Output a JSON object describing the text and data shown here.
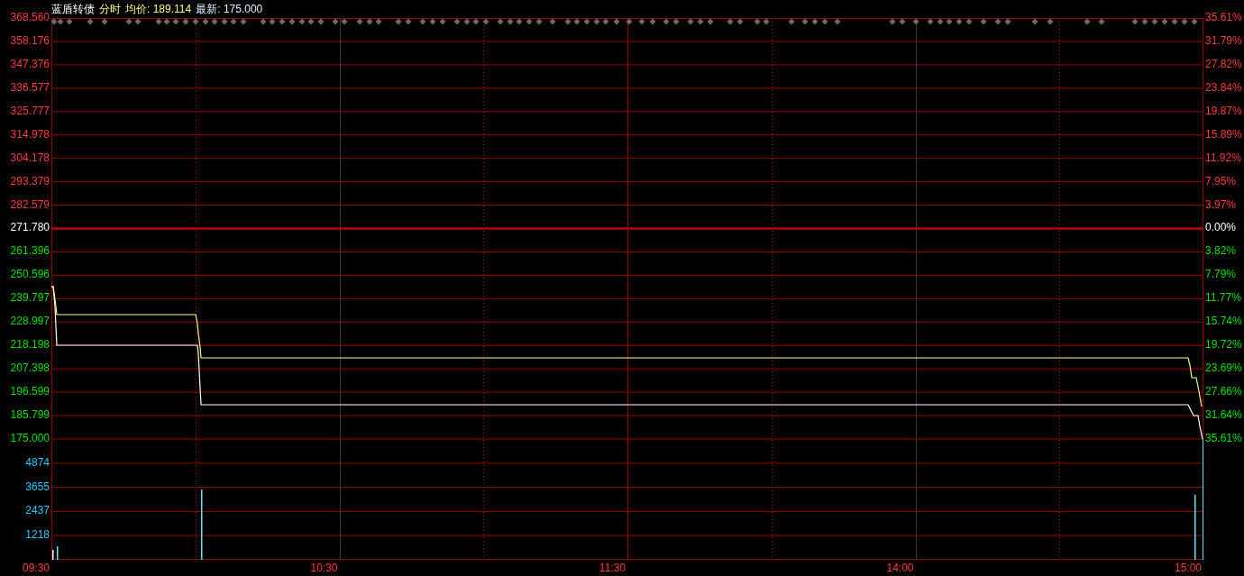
{
  "header": {
    "name": "蓝盾转债",
    "mode": "分时",
    "average": {
      "label": "均价:",
      "value": "189.114"
    },
    "latest": {
      "label": "最新:",
      "value": "175.000"
    }
  },
  "price_axis": [
    {
      "label": "368.560",
      "color": "#ff3b3b"
    },
    {
      "label": "358.176",
      "color": "#ff3b3b"
    },
    {
      "label": "347.376",
      "color": "#ff3b3b"
    },
    {
      "label": "336.577",
      "color": "#ff3b3b"
    },
    {
      "label": "325.777",
      "color": "#ff3b3b"
    },
    {
      "label": "314.978",
      "color": "#ff3b3b"
    },
    {
      "label": "304.178",
      "color": "#ff3b3b"
    },
    {
      "label": "293.379",
      "color": "#ff3b3b"
    },
    {
      "label": "282.579",
      "color": "#ff3b3b"
    },
    {
      "label": "271.780",
      "color": "#ffffff"
    },
    {
      "label": "261.396",
      "color": "#00e600"
    },
    {
      "label": "250.596",
      "color": "#00e600"
    },
    {
      "label": "239.797",
      "color": "#00e600"
    },
    {
      "label": "228.997",
      "color": "#00e600"
    },
    {
      "label": "218.198",
      "color": "#00e600"
    },
    {
      "label": "207.398",
      "color": "#00e600"
    },
    {
      "label": "196.599",
      "color": "#00e600"
    },
    {
      "label": "185.799",
      "color": "#00e600"
    },
    {
      "label": "175.000",
      "color": "#00e600"
    }
  ],
  "percent_axis": [
    {
      "label": "35.61%",
      "color": "#ff3b3b"
    },
    {
      "label": "31.79%",
      "color": "#ff3b3b"
    },
    {
      "label": "27.82%",
      "color": "#ff3b3b"
    },
    {
      "label": "23.84%",
      "color": "#ff3b3b"
    },
    {
      "label": "19.87%",
      "color": "#ff3b3b"
    },
    {
      "label": "15.89%",
      "color": "#ff3b3b"
    },
    {
      "label": "11.92%",
      "color": "#ff3b3b"
    },
    {
      "label": "7.95%",
      "color": "#ff3b3b"
    },
    {
      "label": "3.97%",
      "color": "#ff3b3b"
    },
    {
      "label": "0.00%",
      "color": "#ffffff"
    },
    {
      "label": "3.82%",
      "color": "#00e600"
    },
    {
      "label": "7.79%",
      "color": "#00e600"
    },
    {
      "label": "11.77%",
      "color": "#00e600"
    },
    {
      "label": "15.74%",
      "color": "#00e600"
    },
    {
      "label": "19.72%",
      "color": "#00e600"
    },
    {
      "label": "23.69%",
      "color": "#00e600"
    },
    {
      "label": "27.66%",
      "color": "#00e600"
    },
    {
      "label": "31.64%",
      "color": "#00e600"
    },
    {
      "label": "35.61%",
      "color": "#00e600"
    }
  ],
  "volume_axis": [
    "4874",
    "3655",
    "2437",
    "1218"
  ],
  "time_axis": [
    "09:30",
    "10:30",
    "11:30",
    "14:00",
    "15:00"
  ]
}
